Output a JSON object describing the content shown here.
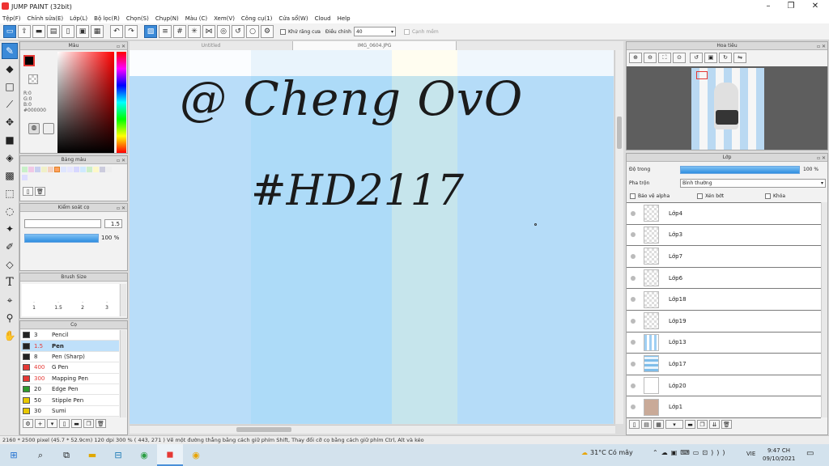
{
  "app": {
    "title": "JUMP PAINT (32bit)"
  },
  "menu": [
    "Tệp(F)",
    "Chỉnh sửa(E)",
    "Lớp(L)",
    "Bộ lọc(R)",
    "Chọn(S)",
    "Chụp(N)",
    "Màu (C)",
    "Xem(V)",
    "Công cụ(1)",
    "Cửa sổ(W)",
    "Cloud",
    "Help"
  ],
  "toolbar": {
    "antialias_label": "Khử răng cưa",
    "correction_label": "Điều chỉnh",
    "correction_value": "40",
    "snap_label": "Cạnh mềm"
  },
  "color_panel": {
    "title": "Màu",
    "r": "R:0",
    "g": "G:0",
    "b": "B:0",
    "hex": "#000000"
  },
  "palette_panel": {
    "title": "Bảng màu"
  },
  "pen_control": {
    "title": "Kiểm soát cọ",
    "size": "1.5",
    "opacity": "100 %"
  },
  "brush_size": {
    "title": "Brush Size",
    "sizes": [
      "1",
      "1.5",
      "2",
      "3"
    ]
  },
  "brush_list": {
    "title": "Cọ",
    "items": [
      {
        "size": "3",
        "name": "Pencil",
        "color": "#222222",
        "selected": false
      },
      {
        "size": "1.5",
        "name": "Pen",
        "color": "#222222",
        "selected": true
      },
      {
        "size": "8",
        "name": "Pen (Sharp)",
        "color": "#222222",
        "selected": false
      },
      {
        "size": "400",
        "name": "G Pen",
        "color": "#e53935",
        "selected": false
      },
      {
        "size": "300",
        "name": "Mapping Pen",
        "color": "#e53935",
        "selected": false
      },
      {
        "size": "20",
        "name": "Edge Pen",
        "color": "#2e9b2e",
        "selected": false
      },
      {
        "size": "50",
        "name": "Stipple Pen",
        "color": "#e8c800",
        "selected": false
      },
      {
        "size": "30",
        "name": "Sumi",
        "color": "#e8c800",
        "selected": false
      }
    ]
  },
  "tabs": [
    "Untitled",
    "IMG_0604.JPG"
  ],
  "canvas": {
    "line1": "@ Cheng OvO",
    "line2": "#HD2117"
  },
  "navigator": {
    "title": "Hoa tiêu"
  },
  "layer_panel": {
    "title": "Lớp",
    "opacity_label": "Độ trong",
    "opacity_value": "100 %",
    "blend_label": "Pha trộn",
    "blend_value": "Bình thường",
    "protect_alpha": "Bảo vệ alpha",
    "clipping": "Xén bớt",
    "lock": "Khóa",
    "layers": [
      "Lớp4",
      "Lớp3",
      "Lớp7",
      "Lớp6",
      "Lớp18",
      "Lớp19",
      "Lớp13",
      "Lớp17",
      "Lớp20",
      "Lớp1"
    ]
  },
  "status": {
    "dims": "2160 * 2500 pixel",
    "physical": "(45.7 * 52.9cm)",
    "dpi": "120 dpi",
    "zoom": "300 %",
    "coords": "( 443, 271 )",
    "hint": "Vẽ một đường thẳng bằng cách giữ phím Shift, Thay đổi cỡ cọ bằng cách giữ phím Ctrl, Alt và kéo"
  },
  "taskbar": {
    "weather": "31°C  Có mây",
    "lang": "VIE",
    "time": "9:47 CH",
    "date": "09/10/2021"
  }
}
